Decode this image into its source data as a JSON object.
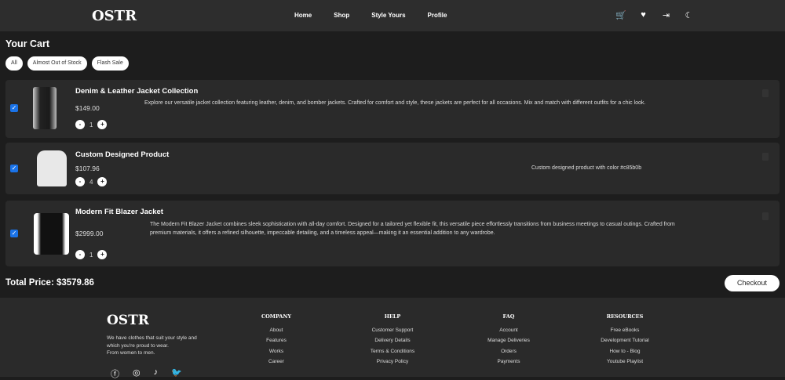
{
  "nav": {
    "logo": "OSTR",
    "links": [
      "Home",
      "Shop",
      "Style Yours",
      "Profile"
    ],
    "icons": [
      "cart-icon",
      "heart-icon",
      "logout-icon",
      "moon-icon"
    ]
  },
  "cart": {
    "title": "Your Cart",
    "filters": [
      "All",
      "Almost Out of Stock",
      "Flash Sale"
    ],
    "items": [
      {
        "title": "Denim & Leather Jacket Collection",
        "price": "$149.00",
        "qty": "1",
        "desc": "Explore our versatile jacket collection featuring leather, denim, and bomber jackets. Crafted for comfort and style, these jackets are perfect for all occasions. Mix and match with different outfits for a chic look."
      },
      {
        "title": "Custom Designed Product",
        "price": "$107.96",
        "qty": "4",
        "desc": "Custom designed product with color #c85b0b"
      },
      {
        "title": "Modern Fit Blazer Jacket",
        "price": "$2999.00",
        "qty": "1",
        "desc": "The Modern Fit Blazer Jacket combines sleek sophistication with all-day comfort. Designed for a tailored yet flexible fit, this versatile piece effortlessly transitions from business meetings to casual outings. Crafted from premium materials, it offers a refined silhouette, impeccable detailing, and a timeless appeal—making it an essential addition to any wardrobe."
      }
    ],
    "minus": "-",
    "plus": "+",
    "check": "✓",
    "total": "Total Price: $3579.86",
    "checkout": "Checkout"
  },
  "footer": {
    "logo": "OSTR",
    "tagline": [
      "We have clothes that suit your style and",
      "which you're proud to wear.",
      "From women to men."
    ],
    "columns": [
      {
        "title": "COMPANY",
        "links": [
          "About",
          "Features",
          "Works",
          "Career"
        ]
      },
      {
        "title": "HELP",
        "links": [
          "Customer Support",
          "Delivery Details",
          "Terms & Conditions",
          "Privacy Policy"
        ]
      },
      {
        "title": "FAQ",
        "links": [
          "Account",
          "Manage Deliveries",
          "Orders",
          "Payments"
        ]
      },
      {
        "title": "RESOURCES",
        "links": [
          "Free eBooks",
          "Development Tutorial",
          "How to - Blog",
          "Youtube Playlist"
        ]
      }
    ],
    "social": [
      "facebook-icon",
      "instagram-icon",
      "tiktok-icon",
      "twitter-icon"
    ]
  }
}
